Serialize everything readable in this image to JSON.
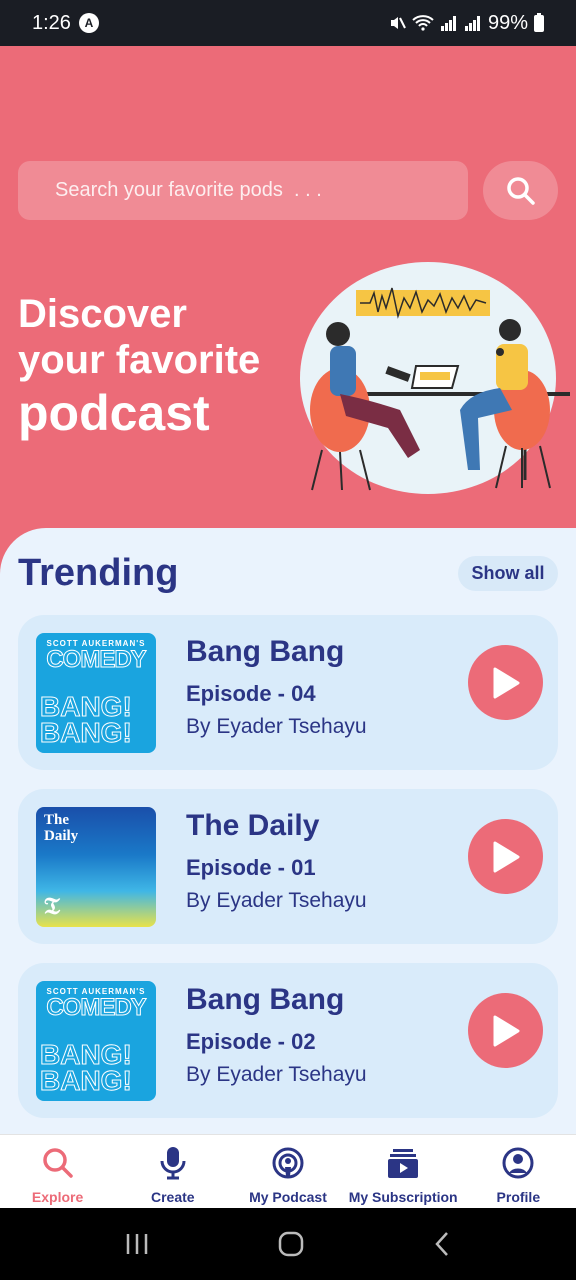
{
  "status_bar": {
    "time": "1:26",
    "badge_letter": "A",
    "battery": "99%"
  },
  "search": {
    "placeholder": "Search your favorite pods  . . ."
  },
  "hero": {
    "line1": "Discover",
    "line2": "your favorite",
    "line3": "podcast"
  },
  "trending": {
    "title": "Trending",
    "show_all": "Show all",
    "items": [
      {
        "title": "Bang Bang",
        "episode": "Episode - 04",
        "author": "By Eyader Tsehayu",
        "cover": {
          "small": "SCOTT AUKERMAN'S",
          "big": "COMEDY",
          "l1": "BANG!",
          "l2": "BANG!"
        }
      },
      {
        "title": "The Daily",
        "episode": "Episode - 01",
        "author": "By Eyader Tsehayu",
        "cover": {
          "t1": "The",
          "t2": "Daily",
          "mark": "𝔗"
        }
      },
      {
        "title": "Bang Bang",
        "episode": "Episode - 02",
        "author": "By Eyader Tsehayu",
        "cover": {
          "small": "SCOTT AUKERMAN'S",
          "big": "COMEDY",
          "l1": "BANG!",
          "l2": "BANG!"
        }
      }
    ]
  },
  "nav": {
    "items": [
      {
        "label": "Explore",
        "icon": "search-icon",
        "active": true
      },
      {
        "label": "Create",
        "icon": "microphone-icon",
        "active": false
      },
      {
        "label": "My Podcast",
        "icon": "podcast-icon",
        "active": false
      },
      {
        "label": "My Subscription",
        "icon": "subscription-icon",
        "active": false
      },
      {
        "label": "Profile",
        "icon": "profile-icon",
        "active": false
      }
    ]
  },
  "colors": {
    "accent": "#ec6b78",
    "primary_text": "#2b3585",
    "card_bg": "#d9ebfa",
    "content_bg": "#eaf3fd"
  }
}
